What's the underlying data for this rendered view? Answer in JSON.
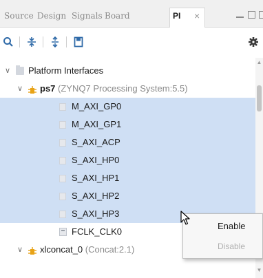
{
  "tabs": [
    {
      "label": "Source"
    },
    {
      "label": "Design"
    },
    {
      "label": "Signals"
    },
    {
      "label": "Board"
    },
    {
      "label": "PI"
    }
  ],
  "tab_close": "×",
  "toolbar": {
    "icons": [
      "search-icon",
      "collapse-all-icon",
      "expand-all-icon",
      "properties-icon",
      "gear-icon"
    ]
  },
  "tree": {
    "root": {
      "label": "Platform Interfaces"
    },
    "ps7": {
      "name": "ps7",
      "detail": "(ZYNQ7 Processing System:5.5)"
    },
    "interfaces": [
      "M_AXI_GP0",
      "M_AXI_GP1",
      "S_AXI_ACP",
      "S_AXI_HP0",
      "S_AXI_HP1",
      "S_AXI_HP2",
      "S_AXI_HP3"
    ],
    "clock": "FCLK_CLK0",
    "xlconcat": {
      "name": "xlconcat_0",
      "detail": "(Concat:2.1)"
    }
  },
  "context_menu": {
    "enable": "Enable",
    "disable": "Disable"
  },
  "colors": {
    "selection": "#cfdff4",
    "accent": "#2f6aa8",
    "ip_icon": "#e8a317"
  }
}
